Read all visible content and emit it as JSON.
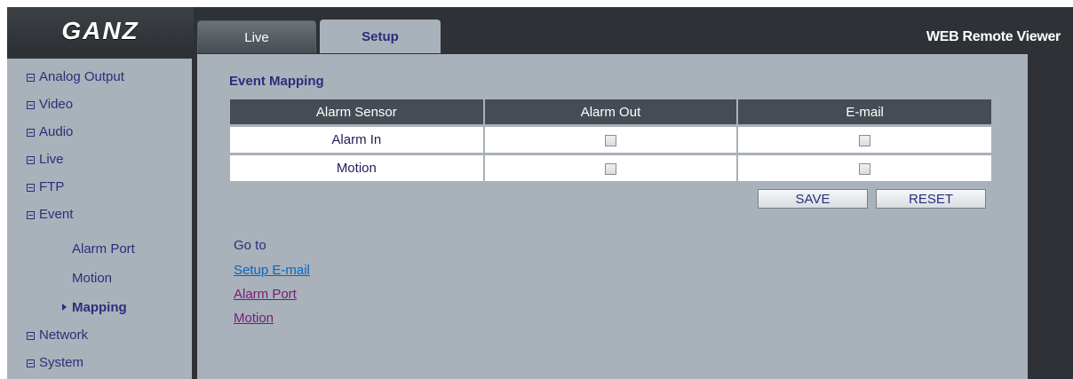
{
  "brand": {
    "logo_text": "GANZ",
    "app_title": "WEB Remote Viewer"
  },
  "tabs": [
    {
      "label": "Live",
      "active": false
    },
    {
      "label": "Setup",
      "active": true
    }
  ],
  "sidebar": {
    "items": [
      {
        "label": "Analog Output",
        "icon": "collapse-box-icon"
      },
      {
        "label": "Video",
        "icon": "collapse-box-icon"
      },
      {
        "label": "Audio",
        "icon": "collapse-box-icon"
      },
      {
        "label": "Live",
        "icon": "collapse-box-icon"
      },
      {
        "label": "FTP",
        "icon": "collapse-box-icon"
      },
      {
        "label": "Event",
        "icon": "collapse-box-icon"
      },
      {
        "label": "Network",
        "icon": "collapse-box-icon"
      },
      {
        "label": "System",
        "icon": "collapse-box-icon"
      }
    ],
    "event_subitems": [
      {
        "label": "Alarm Port",
        "active": false
      },
      {
        "label": "Motion",
        "active": false
      },
      {
        "label": "Mapping",
        "active": true
      }
    ]
  },
  "main": {
    "title": "Event Mapping",
    "table": {
      "headers": [
        "Alarm Sensor",
        "Alarm Out",
        "E-mail"
      ],
      "rows": [
        {
          "sensor": "Alarm In",
          "alarm_out": false,
          "email": false
        },
        {
          "sensor": "Motion",
          "alarm_out": false,
          "email": false
        }
      ]
    },
    "buttons": {
      "save": "SAVE",
      "reset": "RESET"
    },
    "goto": {
      "label": "Go to",
      "links": [
        {
          "label": "Setup E-mail",
          "color": "#0066cc"
        },
        {
          "label": "Alarm Port",
          "color": "#7a1a7a"
        },
        {
          "label": "Motion",
          "color": "#7a1a7a"
        }
      ]
    }
  },
  "colors": {
    "panel": "#a9b1ba",
    "chrome": "#2e3236",
    "text": "#2b2e7a",
    "table_header": "#474c54"
  }
}
